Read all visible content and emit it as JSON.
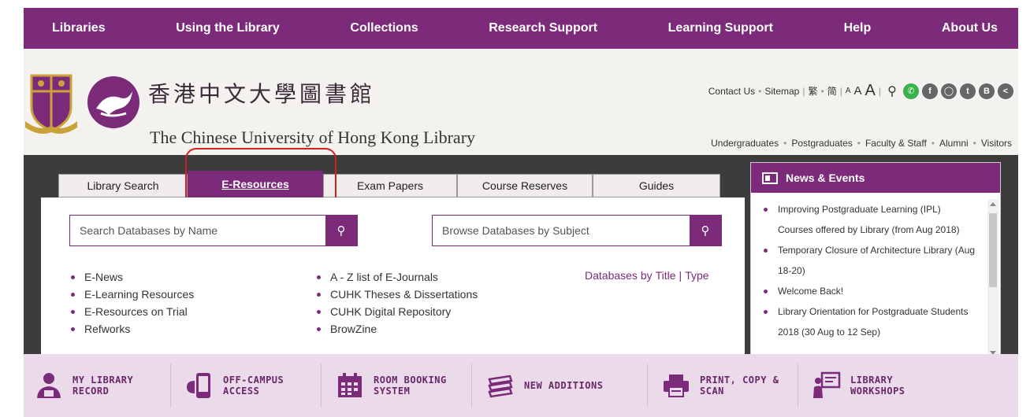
{
  "topnav": [
    "Libraries",
    "Using the Library",
    "Collections",
    "Research Support",
    "Learning Support",
    "Help",
    "About Us"
  ],
  "header": {
    "name_cn": "香港中文大學圖書館",
    "name_en": "The Chinese University of Hong Kong Library",
    "utility": {
      "contact": "Contact Us",
      "sitemap": "Sitemap",
      "trad": "繁",
      "simp": "简",
      "font_small": "A",
      "font_medium": "A",
      "font_large": "A"
    },
    "social_icons": [
      "search-icon",
      "whatsapp-icon",
      "facebook-icon",
      "instagram-icon",
      "twitter-icon",
      "blog-icon",
      "share-icon"
    ],
    "audience": [
      "Undergraduates",
      "Postgraduates",
      "Faculty & Staff",
      "Alumni",
      "Visitors"
    ]
  },
  "tabs": [
    "Library Search",
    "E-Resources",
    "Exam Papers",
    "Course Reserves",
    "Guides"
  ],
  "active_tab": "E-Resources",
  "search": {
    "by_name_placeholder": "Search Databases by Name",
    "by_subject_placeholder": "Browse Databases by Subject"
  },
  "links_left": [
    "E-News",
    "E-Learning Resources",
    "E-Resources on Trial",
    "Refworks"
  ],
  "links_middle": [
    "A - Z list of E-Journals",
    "CUHK Theses & Dissertations",
    "CUHK Digital Repository",
    "BrowZine"
  ],
  "databases_by": {
    "prefix": "Databases by",
    "title": "Title",
    "separator": "|",
    "type": "Type"
  },
  "news": {
    "heading": "News & Events",
    "items": [
      "Improving Postgraduate Learning (IPL) Courses offered by Library (from Aug 2018)",
      "Temporary Closure of Architecture Library (Aug 18-20)",
      "Welcome Back!",
      "Library Orientation for Postgraduate Students 2018 (30 Aug to 12 Sep)"
    ]
  },
  "quick_links": [
    {
      "line1": "MY LIBRARY",
      "line2": "RECORD",
      "icon": "user-record-icon"
    },
    {
      "line1": "OFF-CAMPUS",
      "line2": "ACCESS",
      "icon": "mobile-access-icon"
    },
    {
      "line1": "ROOM BOOKING",
      "line2": "SYSTEM",
      "icon": "calendar-icon"
    },
    {
      "line1": "NEW ADDITIONS",
      "line2": "",
      "icon": "books-stack-icon"
    },
    {
      "line1": "PRINT, COPY &",
      "line2": "SCAN",
      "icon": "printer-icon"
    },
    {
      "line1": "LIBRARY",
      "line2": "WORKSHOPS",
      "icon": "presentation-icon"
    }
  ],
  "colors": {
    "brand": "#7b2b7a",
    "dark_band": "#3c3c3c",
    "quick_bar": "#eadaea",
    "highlight": "#d21f1f"
  }
}
